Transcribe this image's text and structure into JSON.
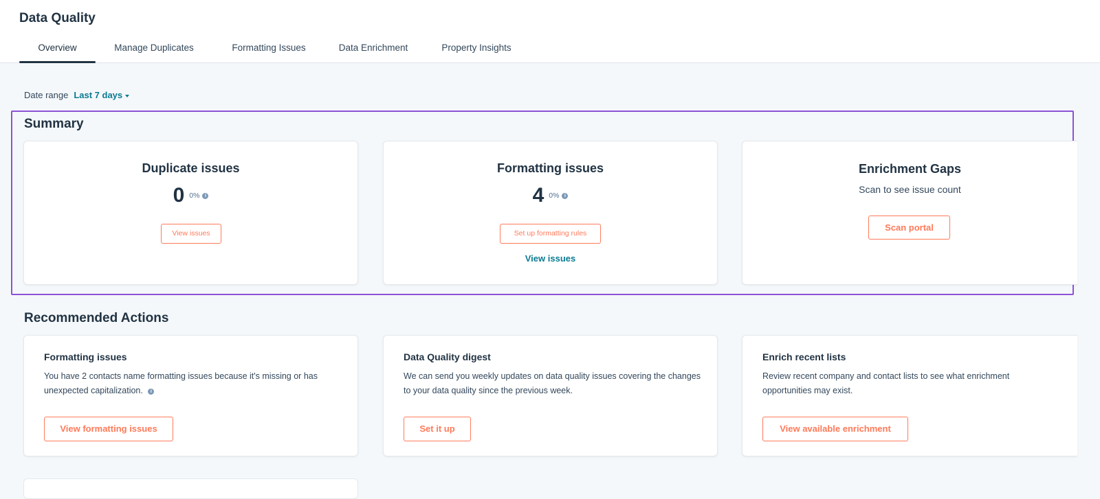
{
  "header": {
    "title": "Data Quality",
    "tabs": [
      {
        "label": "Overview",
        "active": true
      },
      {
        "label": "Manage Duplicates"
      },
      {
        "label": "Formatting Issues"
      },
      {
        "label": "Data Enrichment"
      },
      {
        "label": "Property Insights"
      }
    ]
  },
  "date_range": {
    "label": "Date range",
    "value": "Last 7 days"
  },
  "summary": {
    "title": "Summary",
    "cards": [
      {
        "heading": "Duplicate issues",
        "count": "0",
        "percent": "0%",
        "button": "View issues"
      },
      {
        "heading": "Formatting issues",
        "count": "4",
        "percent": "0%",
        "button": "Set up formatting rules",
        "link": "View issues"
      },
      {
        "heading": "Enrichment Gaps",
        "subtext": "Scan to see issue count",
        "button": "Scan portal"
      }
    ]
  },
  "recommended": {
    "title": "Recommended Actions",
    "cards": [
      {
        "heading": "Formatting issues",
        "body": "You have 2 contacts name formatting issues because it's missing or has unexpected capitalization.",
        "button": "View formatting issues"
      },
      {
        "heading": "Data Quality digest",
        "body": "We can send you weekly updates on data quality issues covering the changes to your data quality since the previous week.",
        "button": "Set it up"
      },
      {
        "heading": "Enrich recent lists",
        "body": "Review recent company and contact lists to see what enrichment opportunities may exist.",
        "button": "View available enrichment"
      }
    ]
  },
  "colors": {
    "accent": "#ff7a59",
    "link": "#0b7a92",
    "highlight_outline": "#8d51d6",
    "text_dark": "#213343"
  }
}
